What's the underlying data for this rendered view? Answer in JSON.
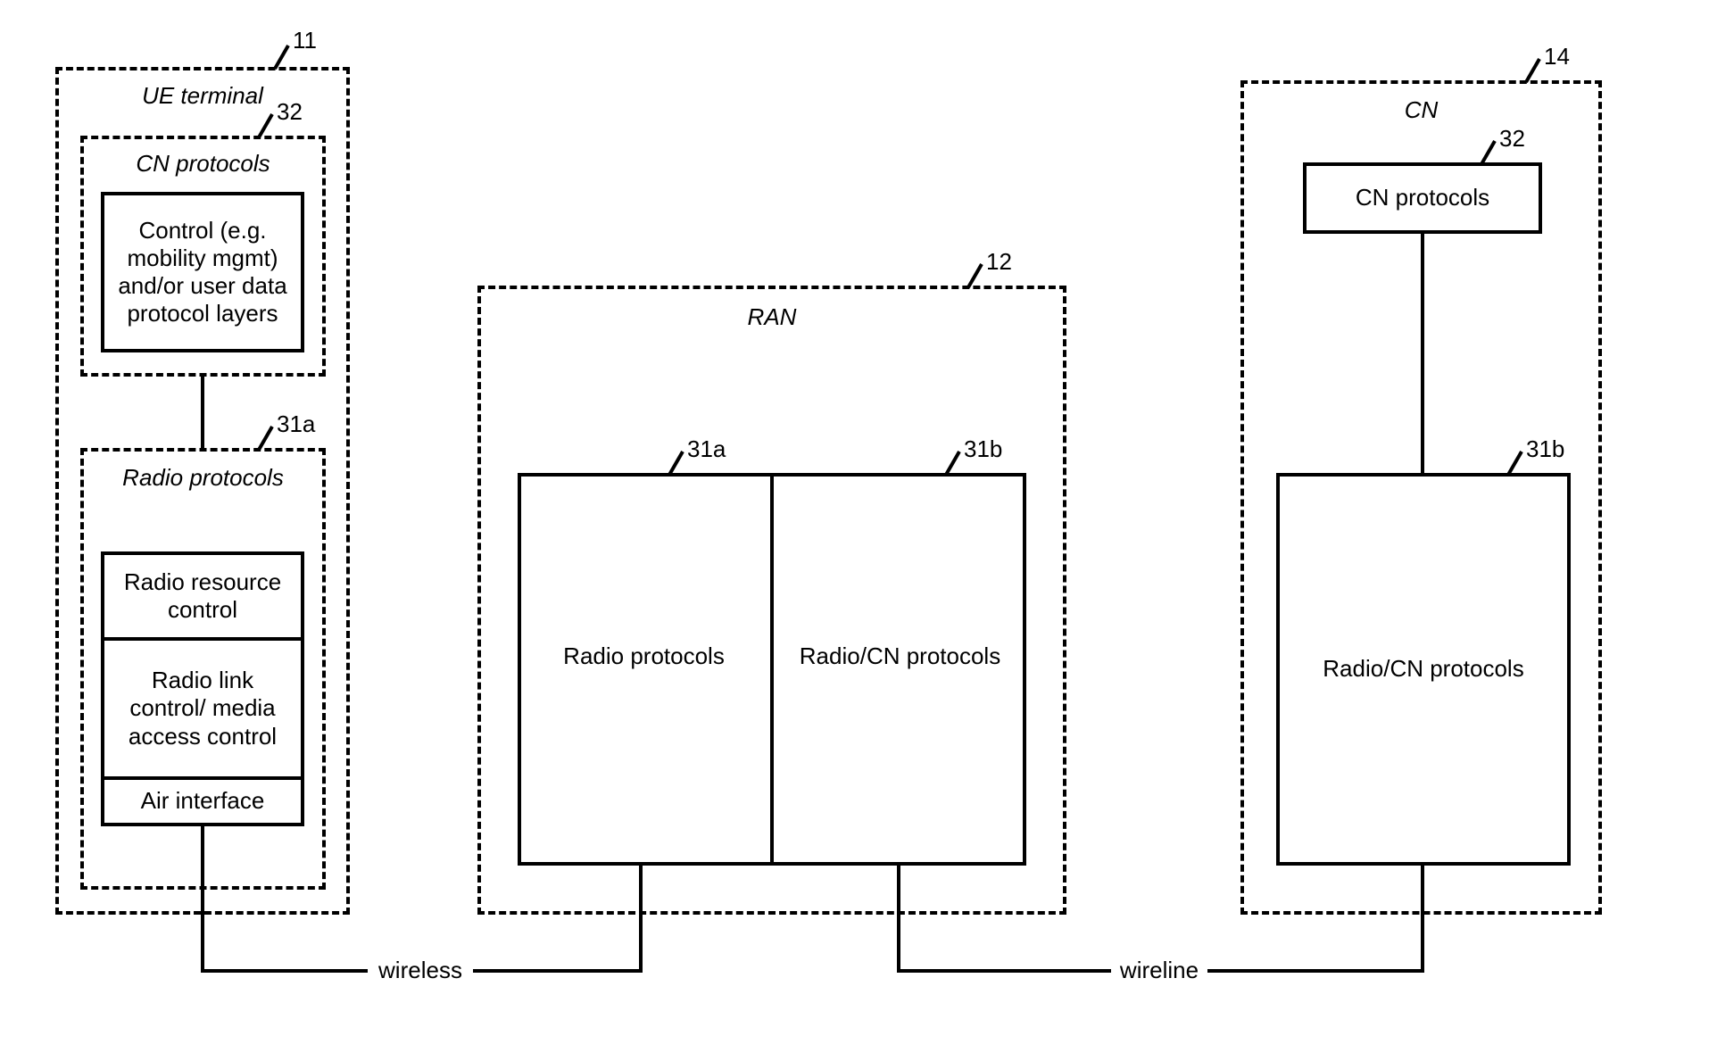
{
  "ue": {
    "title": "UE terminal",
    "ref": "11",
    "cn_protocols": {
      "title": "CN protocols",
      "ref": "32",
      "inner": "Control (e.g.\nmobility mgmt)\nand/or user data\nprotocol layers"
    },
    "radio_protocols": {
      "title": "Radio protocols",
      "ref": "31a",
      "rrc": "Radio resource\ncontrol",
      "rlc": "Radio link\ncontrol/ media\naccess control",
      "air": "Air interface"
    }
  },
  "ran": {
    "title": "RAN",
    "ref": "12",
    "left": {
      "label": "Radio protocols",
      "ref": "31a"
    },
    "right": {
      "label": "Radio/CN protocols",
      "ref": "31b"
    }
  },
  "cn": {
    "title": "CN",
    "ref": "14",
    "top": {
      "label": "CN protocols",
      "ref": "32"
    },
    "bottom": {
      "label": "Radio/CN protocols",
      "ref": "31b"
    }
  },
  "links": {
    "wireless": "wireless",
    "wireline": "wireline"
  }
}
